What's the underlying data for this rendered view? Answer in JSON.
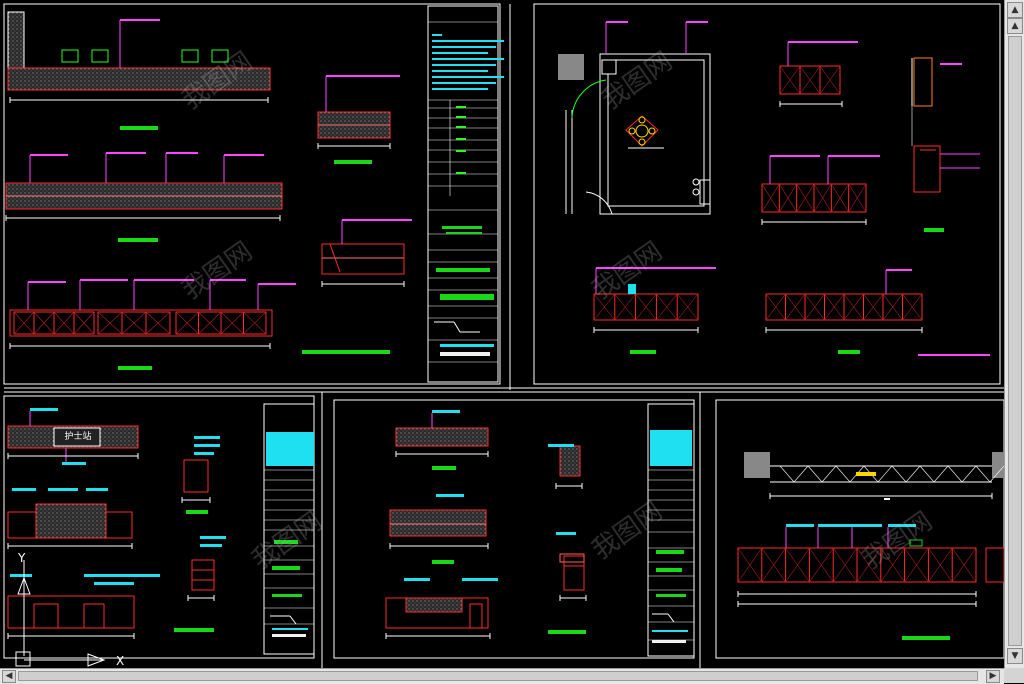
{
  "drawing": {
    "sheets": [
      {
        "id": "sheet-top-left",
        "title_block_title": "",
        "note": ""
      },
      {
        "id": "sheet-top-right",
        "title_block_title": "",
        "note": ""
      },
      {
        "id": "sheet-bottom-left",
        "label": "护士站"
      },
      {
        "id": "sheet-bottom-middle"
      },
      {
        "id": "sheet-bottom-right"
      }
    ],
    "nurse_station_label": "护士站",
    "watermark": "我图网",
    "colors": {
      "background": "#000000",
      "frame": "#ffffff",
      "outline": "#ff2a2a",
      "leader": "#ff44ff",
      "dimension": "#ffffff",
      "label_fill": "#1fe0f0",
      "title_green": "#18d818",
      "hatch": "#9a9a9a",
      "cad_green": "#22ff22"
    },
    "ucs_labels": {
      "y": "Y",
      "x": "X"
    }
  },
  "scrollbars": {
    "up_arrow": "▲",
    "down_arrow": "▼",
    "left_arrow": "◀",
    "right_arrow": "▶"
  }
}
